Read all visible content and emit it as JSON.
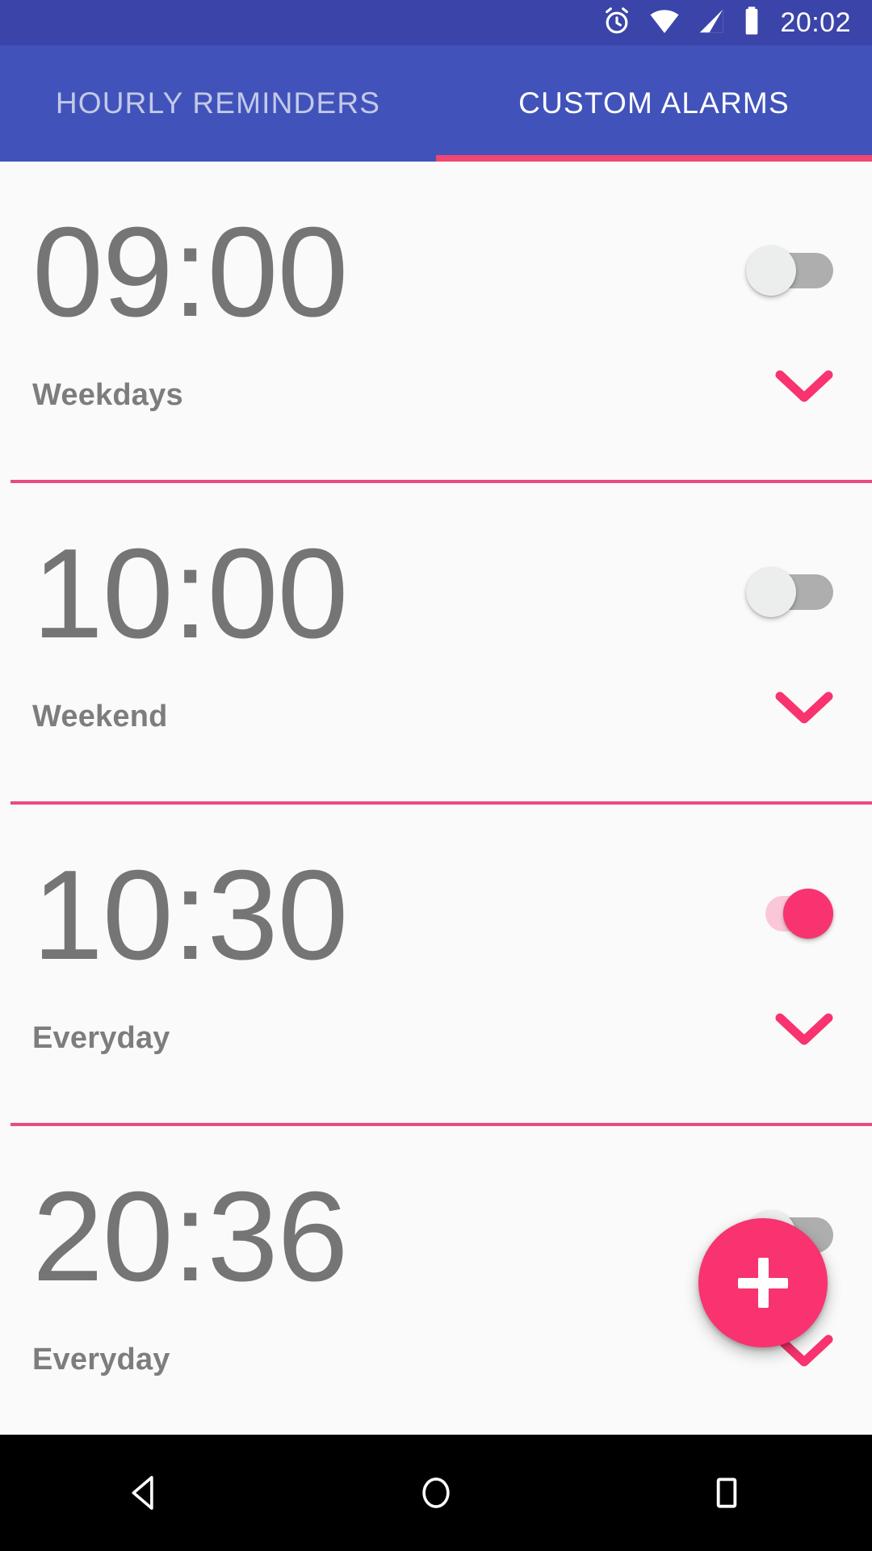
{
  "statusbar": {
    "time": "20:02",
    "icons": [
      "alarm-clock-icon",
      "wifi-icon",
      "cell-signal-icon",
      "battery-icon"
    ]
  },
  "tabs": [
    {
      "label": "HOURLY REMINDERS",
      "active": false
    },
    {
      "label": "CUSTOM ALARMS",
      "active": true
    }
  ],
  "alarms": [
    {
      "time": "09:00",
      "repeat": "Weekdays",
      "enabled": false
    },
    {
      "time": "10:00",
      "repeat": "Weekend",
      "enabled": false
    },
    {
      "time": "10:30",
      "repeat": "Everyday",
      "enabled": true
    },
    {
      "time": "20:36",
      "repeat": "Everyday",
      "enabled": false
    }
  ],
  "fab": {
    "label": "+",
    "name": "add-alarm-button"
  },
  "navbar": {
    "back": "back-button",
    "home": "home-button",
    "recents": "recents-button"
  },
  "colors": {
    "status_bar": "#3b44a8",
    "app_bar": "#4153ba",
    "accent_pink": "#f8336f",
    "divider_pink": "#e84b82",
    "time_text": "#757575",
    "background": "#fafafa"
  }
}
